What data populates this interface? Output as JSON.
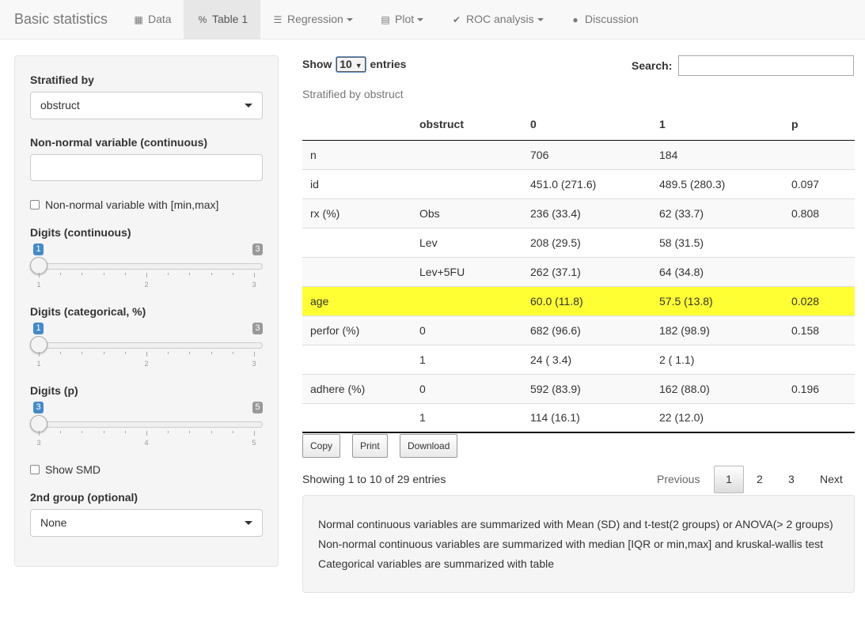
{
  "navbar": {
    "brand": "Basic statistics",
    "tabs": [
      {
        "label": "Data",
        "icon": "table-icon"
      },
      {
        "label": "Table 1",
        "icon": "percent-icon"
      },
      {
        "label": "Regression",
        "icon": "list-icon"
      },
      {
        "label": "Plot",
        "icon": "bar-chart-icon"
      },
      {
        "label": "ROC analysis",
        "icon": "check-icon"
      },
      {
        "label": "Discussion",
        "icon": "comment-icon"
      }
    ],
    "active_tab": "Table 1"
  },
  "sidebar": {
    "stratified_label": "Stratified by",
    "stratified_value": "obstruct",
    "nonnormal_label": "Non-normal variable (continuous)",
    "nonnormal_value": "",
    "minmax_label": "Non-normal variable with [min,max]",
    "sliders": [
      {
        "label": "Digits (continuous)",
        "value": "1",
        "min": "1",
        "max": "3",
        "ticks": [
          "1",
          "2",
          "3"
        ]
      },
      {
        "label": "Digits (categorical, %)",
        "value": "1",
        "min": "1",
        "max": "3",
        "ticks": [
          "1",
          "2",
          "3"
        ]
      },
      {
        "label": "Digits (p)",
        "value": "3",
        "min": "3",
        "max": "5",
        "ticks": [
          "3",
          "4",
          "5"
        ]
      }
    ],
    "smd_label": "Show SMD",
    "group2_label": "2nd group (optional)",
    "group2_value": "None"
  },
  "main": {
    "show_label": "Show",
    "page_length": "10",
    "entries_label": "entries",
    "search_label": "Search:",
    "search_value": "",
    "caption": "Stratified by obstruct",
    "columns": [
      "",
      "obstruct",
      "0",
      "1",
      "p"
    ],
    "rows": [
      [
        "n",
        "",
        "706",
        "184",
        ""
      ],
      [
        "id",
        "",
        "451.0 (271.6)",
        "489.5 (280.3)",
        "0.097"
      ],
      [
        "rx (%)",
        "Obs",
        "236 (33.4)",
        "62 (33.7)",
        "0.808"
      ],
      [
        "",
        "Lev",
        "208 (29.5)",
        "58 (31.5)",
        ""
      ],
      [
        "",
        "Lev+5FU",
        "262 (37.1)",
        "64 (34.8)",
        ""
      ],
      [
        "age",
        "",
        "60.0 (11.8)",
        "57.5 (13.8)",
        "0.028"
      ],
      [
        "perfor (%)",
        "0",
        "682 (96.6)",
        "182 (98.9)",
        "0.158"
      ],
      [
        "",
        "1",
        "24 ( 3.4)",
        "2 ( 1.1)",
        ""
      ],
      [
        "adhere (%)",
        "0",
        "592 (83.9)",
        "162 (88.0)",
        "0.196"
      ],
      [
        "",
        "1",
        "114 (16.1)",
        "22 (12.0)",
        ""
      ]
    ],
    "highlighted_row": "age",
    "highlight_color": "#ffff33",
    "buttons": {
      "copy": "Copy",
      "print": "Print",
      "download": "Download"
    },
    "info": "Showing 1 to 10 of 29 entries",
    "pagination": {
      "previous": "Previous",
      "pages": [
        "1",
        "2",
        "3"
      ],
      "current": "1",
      "next": "Next"
    },
    "notes": [
      "Normal continuous variables are summarized with Mean (SD) and t-test(2 groups) or ANOVA(> 2 groups)",
      "Non-normal continuous variables are summarized with median [IQR or min,max] and kruskal-wallis test",
      "Categorical variables are summarized with table"
    ]
  }
}
